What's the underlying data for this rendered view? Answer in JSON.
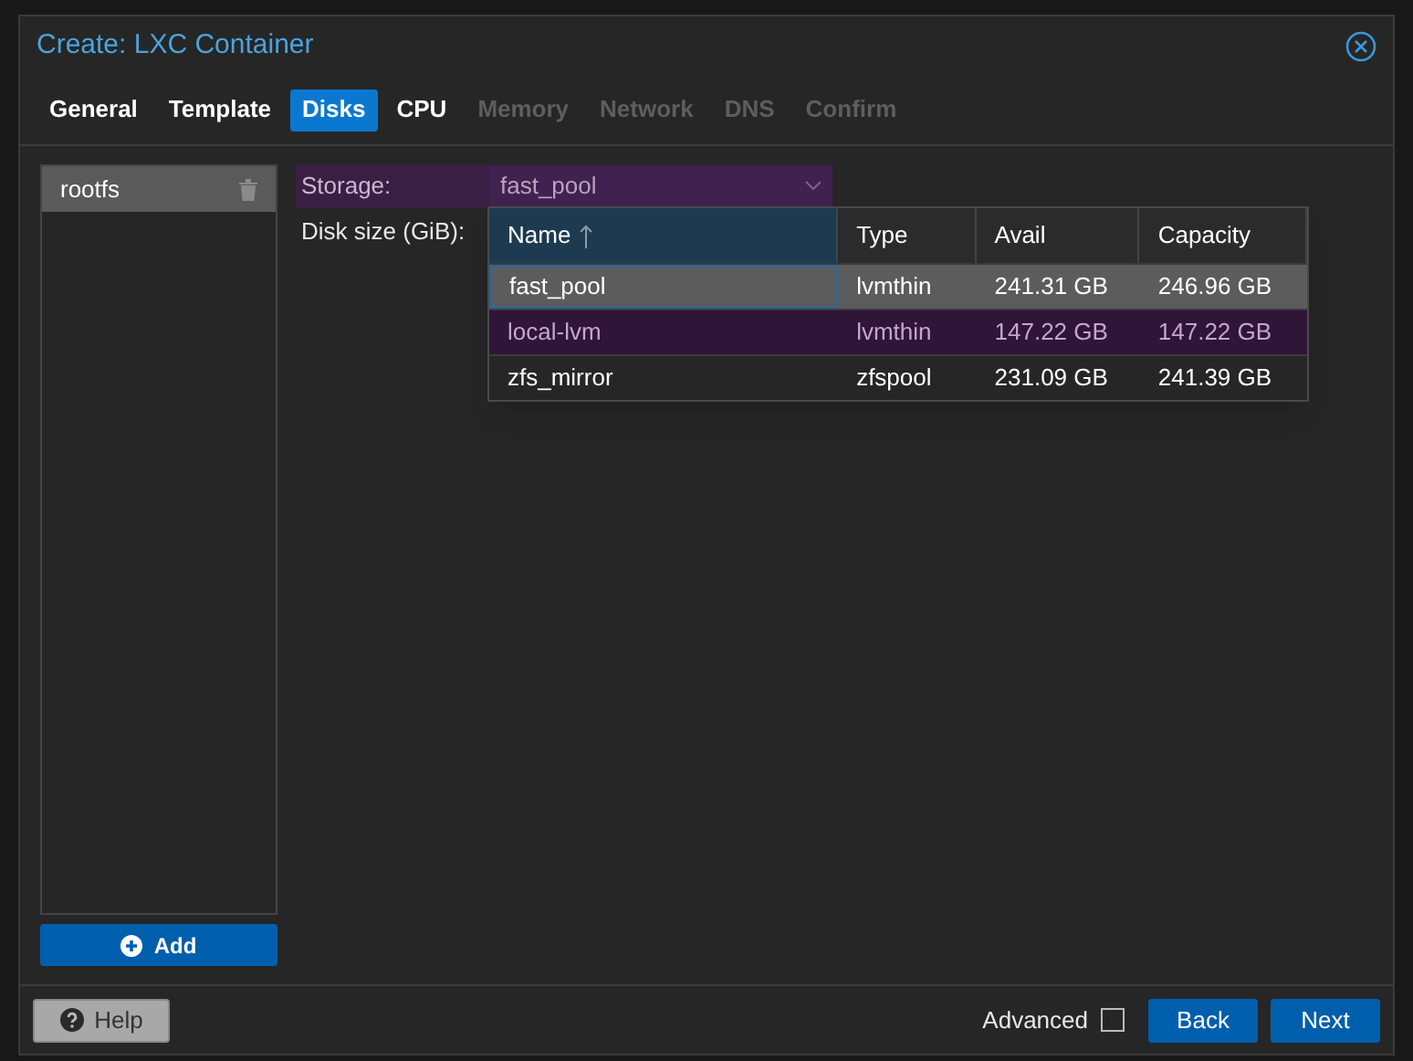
{
  "window": {
    "title": "Create: LXC Container"
  },
  "tabs": [
    {
      "label": "General",
      "selected": false,
      "disabled": false
    },
    {
      "label": "Template",
      "selected": false,
      "disabled": false
    },
    {
      "label": "Disks",
      "selected": true,
      "disabled": false
    },
    {
      "label": "CPU",
      "selected": false,
      "disabled": false
    },
    {
      "label": "Memory",
      "selected": false,
      "disabled": true
    },
    {
      "label": "Network",
      "selected": false,
      "disabled": true
    },
    {
      "label": "DNS",
      "selected": false,
      "disabled": true
    },
    {
      "label": "Confirm",
      "selected": false,
      "disabled": true
    }
  ],
  "disks": [
    {
      "label": "rootfs",
      "selected": true
    }
  ],
  "add_button": "Add",
  "form": {
    "storage": {
      "label": "Storage:",
      "value": "fast_pool",
      "highlighted": true
    },
    "disk_size": {
      "label": "Disk size (GiB):"
    }
  },
  "dropdown": {
    "columns": [
      {
        "label": "Name",
        "sorted": true
      },
      {
        "label": "Type"
      },
      {
        "label": "Avail"
      },
      {
        "label": "Capacity"
      }
    ],
    "rows": [
      {
        "cells": [
          "fast_pool",
          "lvmthin",
          "241.31 GB",
          "246.96 GB"
        ],
        "selected": true,
        "hovered": false
      },
      {
        "cells": [
          "local-lvm",
          "lvmthin",
          "147.22 GB",
          "147.22 GB"
        ],
        "selected": false,
        "hovered": true
      },
      {
        "cells": [
          "zfs_mirror",
          "zfspool",
          "231.09 GB",
          "241.39 GB"
        ],
        "selected": false,
        "hovered": false
      }
    ]
  },
  "footer": {
    "help": "Help",
    "advanced": {
      "label": "Advanced",
      "checked": false
    },
    "back": "Back",
    "next": "Next"
  }
}
